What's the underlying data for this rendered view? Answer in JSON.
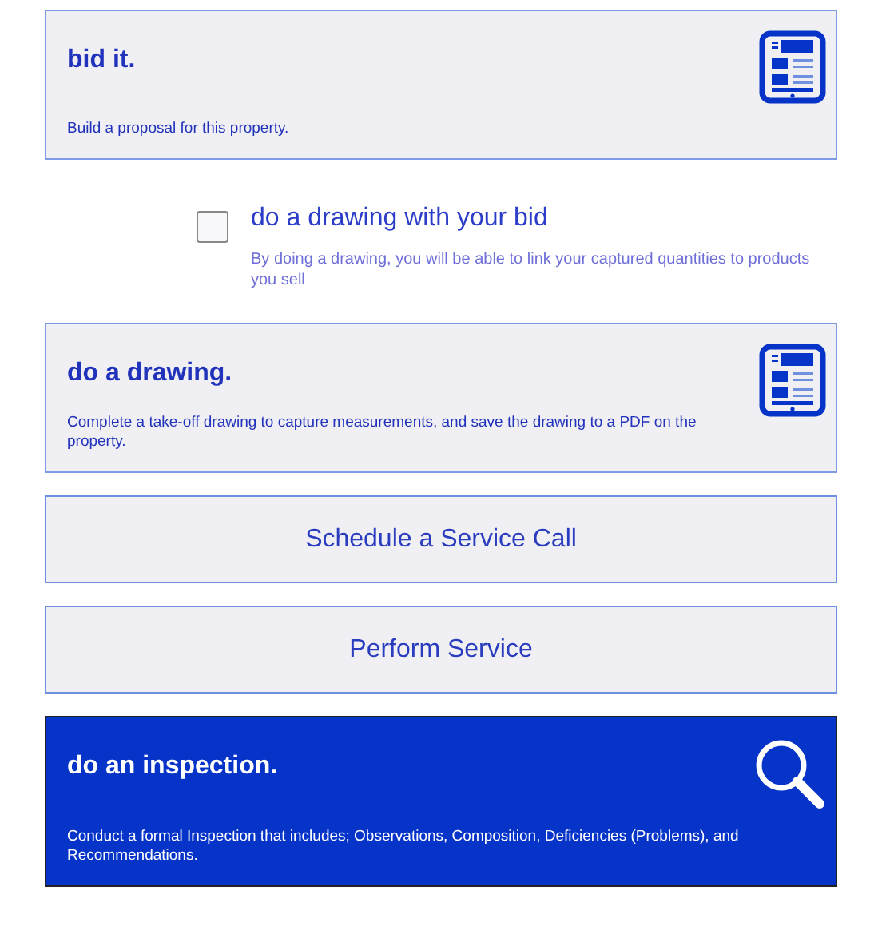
{
  "items": [
    {
      "kind": "card",
      "title": "bid it.",
      "description": "Build a proposal for this property.",
      "selected": false
    },
    {
      "kind": "checkbox",
      "label": "do a drawing with your bid",
      "description": "By doing a drawing, you will be able to link your captured quantities to products you sell",
      "checked": false
    },
    {
      "kind": "card",
      "title": "do a drawing.",
      "description": "Complete a take-off drawing to capture measurements, and save the drawing to a PDF on the property.",
      "selected": false
    },
    {
      "kind": "button",
      "label": "Schedule a Service Call"
    },
    {
      "kind": "button",
      "label": "Perform Service"
    },
    {
      "kind": "inspect-card",
      "title": "do an inspection.",
      "description": "Conduct a formal Inspection that includes; Observations, Composition, Deficiencies (Problems), and Recommendations.",
      "selected": true
    }
  ]
}
